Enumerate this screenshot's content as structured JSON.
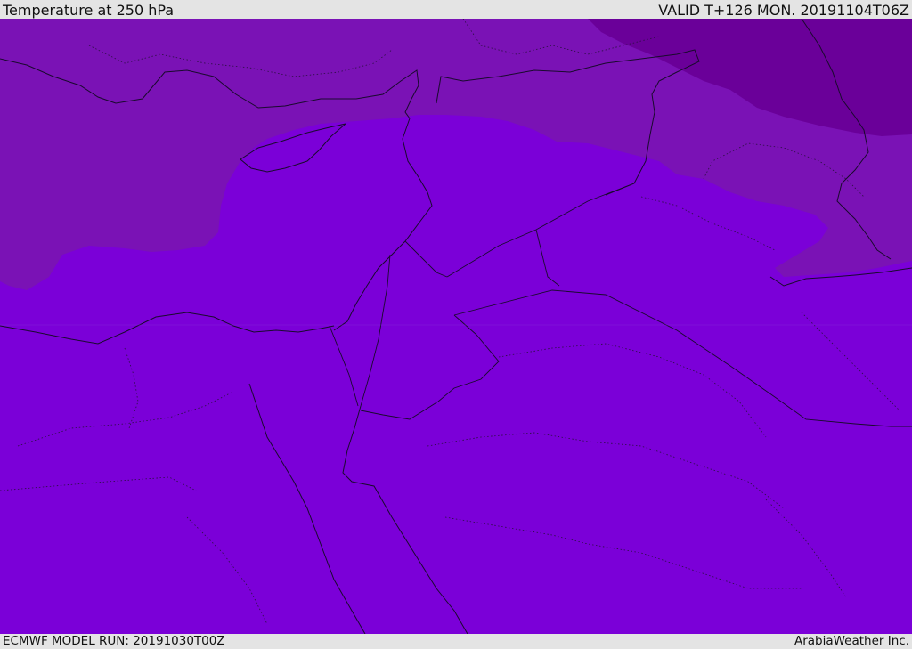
{
  "header": {
    "title": "Temperature at 250 hPa",
    "valid": "VALID T+126 MON. 20191104T06Z"
  },
  "footer": {
    "model_run": "ECMWF MODEL RUN: 20191030T00Z",
    "credit": "ArabiaWeather Inc."
  },
  "map": {
    "colors": {
      "base": "#7b00d8",
      "band_mid": "#7a12b5",
      "band_cold": "#6a0099",
      "coast": "#1a0a2e"
    }
  }
}
